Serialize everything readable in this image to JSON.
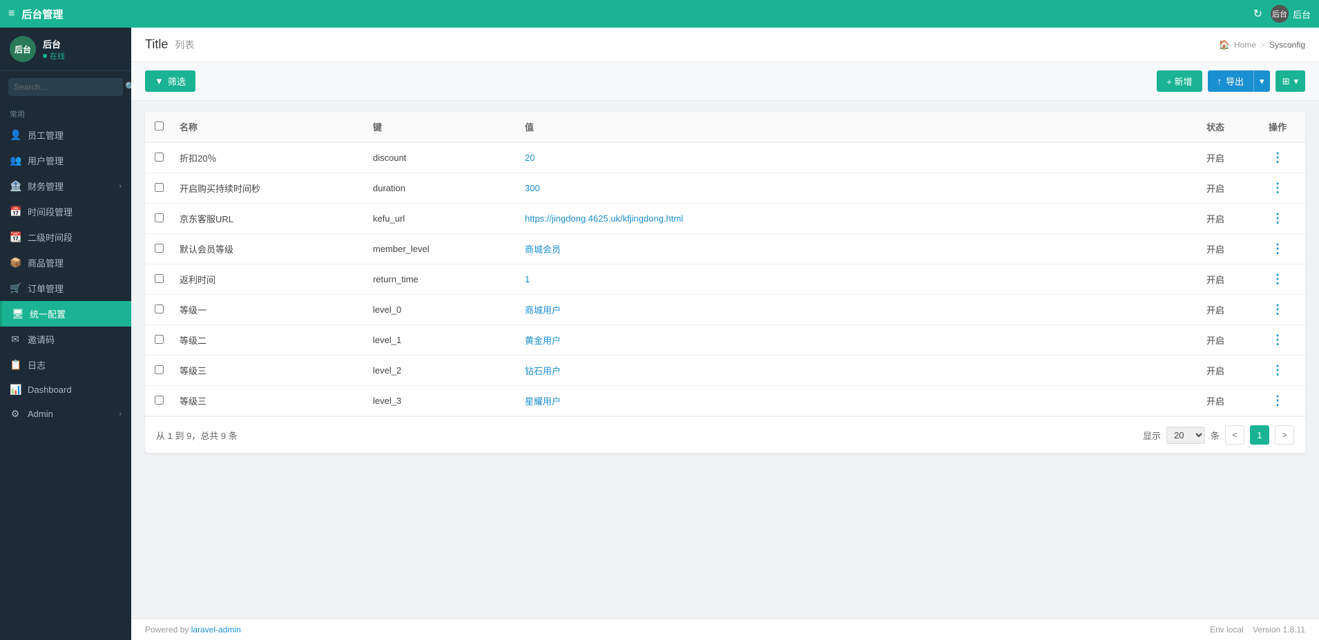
{
  "topBar": {
    "title": "后台管理",
    "hamburger": "≡",
    "refreshIcon": "↻",
    "userLabel": "后台"
  },
  "sidebar": {
    "brandName": "后台",
    "brandAvatarText": "后台",
    "statusText": "在线",
    "searchPlaceholder": "Search...",
    "sectionLabel": "常用",
    "items": [
      {
        "id": "staff",
        "icon": "👤",
        "label": "员工管理",
        "hasChevron": false
      },
      {
        "id": "users",
        "icon": "👥",
        "label": "用户管理",
        "hasChevron": false
      },
      {
        "id": "finance",
        "icon": "🏦",
        "label": "财务管理",
        "hasChevron": true
      },
      {
        "id": "timeslot",
        "icon": "📅",
        "label": "时间段管理",
        "hasChevron": false
      },
      {
        "id": "timeslot2",
        "icon": "📆",
        "label": "二级时间段",
        "hasChevron": false
      },
      {
        "id": "goods",
        "icon": "📦",
        "label": "商品管理",
        "hasChevron": false
      },
      {
        "id": "orders",
        "icon": "🛒",
        "label": "订单管理",
        "hasChevron": false
      },
      {
        "id": "sysconfig",
        "icon": "🖥",
        "label": "统一配置",
        "hasChevron": false,
        "active": true
      },
      {
        "id": "invite",
        "icon": "✉",
        "label": "邀请码",
        "hasChevron": false
      },
      {
        "id": "logs",
        "icon": "📋",
        "label": "日志",
        "hasChevron": false
      },
      {
        "id": "dashboard",
        "icon": "📊",
        "label": "Dashboard",
        "hasChevron": false
      },
      {
        "id": "admin",
        "icon": "⚙",
        "label": "Admin",
        "hasChevron": true
      }
    ]
  },
  "pageHeader": {
    "title": "Title",
    "subtitle": "列表",
    "breadcrumb": {
      "home": "Home",
      "separator": ">",
      "current": "Sysconfig"
    }
  },
  "toolbar": {
    "filterLabel": "筛选",
    "addLabel": "+ 新增",
    "exportLabel": "导出",
    "columnsIcon": "⊞"
  },
  "table": {
    "columns": [
      "",
      "名称",
      "键",
      "值",
      "状态",
      "操作"
    ],
    "rows": [
      {
        "name": "折扣20％",
        "key": "discount",
        "value": "20",
        "isLink": true,
        "status": "开启"
      },
      {
        "name": "开启购买持续时间秒",
        "key": "duration",
        "value": "300",
        "isLink": true,
        "status": "开启"
      },
      {
        "name": "京东客服URL",
        "key": "kefu_url",
        "value": "https://jingdong.4625.uk/kfjingdong.html",
        "isLink": true,
        "status": "开启"
      },
      {
        "name": "默认会员等级",
        "key": "member_level",
        "value": "商城会员",
        "isLink": true,
        "status": "开启"
      },
      {
        "name": "返利时间",
        "key": "return_time",
        "value": "1",
        "isLink": true,
        "status": "开启"
      },
      {
        "name": "等级一",
        "key": "level_0",
        "value": "商城用户",
        "isLink": true,
        "status": "开启"
      },
      {
        "name": "等级二",
        "key": "level_1",
        "value": "黄金用户",
        "isLink": true,
        "status": "开启"
      },
      {
        "name": "等级三",
        "key": "level_2",
        "value": "钻石用户",
        "isLink": true,
        "status": "开启"
      },
      {
        "name": "等级三",
        "key": "level_3",
        "value": "星耀用户",
        "isLink": true,
        "status": "开启"
      }
    ]
  },
  "pagination": {
    "info": "从 1 到 9，总共 9 条",
    "displayLabel": "显示",
    "pageSize": "20",
    "unit": "条",
    "prevIcon": "<",
    "nextIcon": ">",
    "currentPage": "1"
  },
  "footer": {
    "poweredBy": "Powered by",
    "link": "laravel-admin",
    "envLabel": "Env",
    "envValue": "local",
    "versionLabel": "Version",
    "versionValue": "1.8.11"
  }
}
